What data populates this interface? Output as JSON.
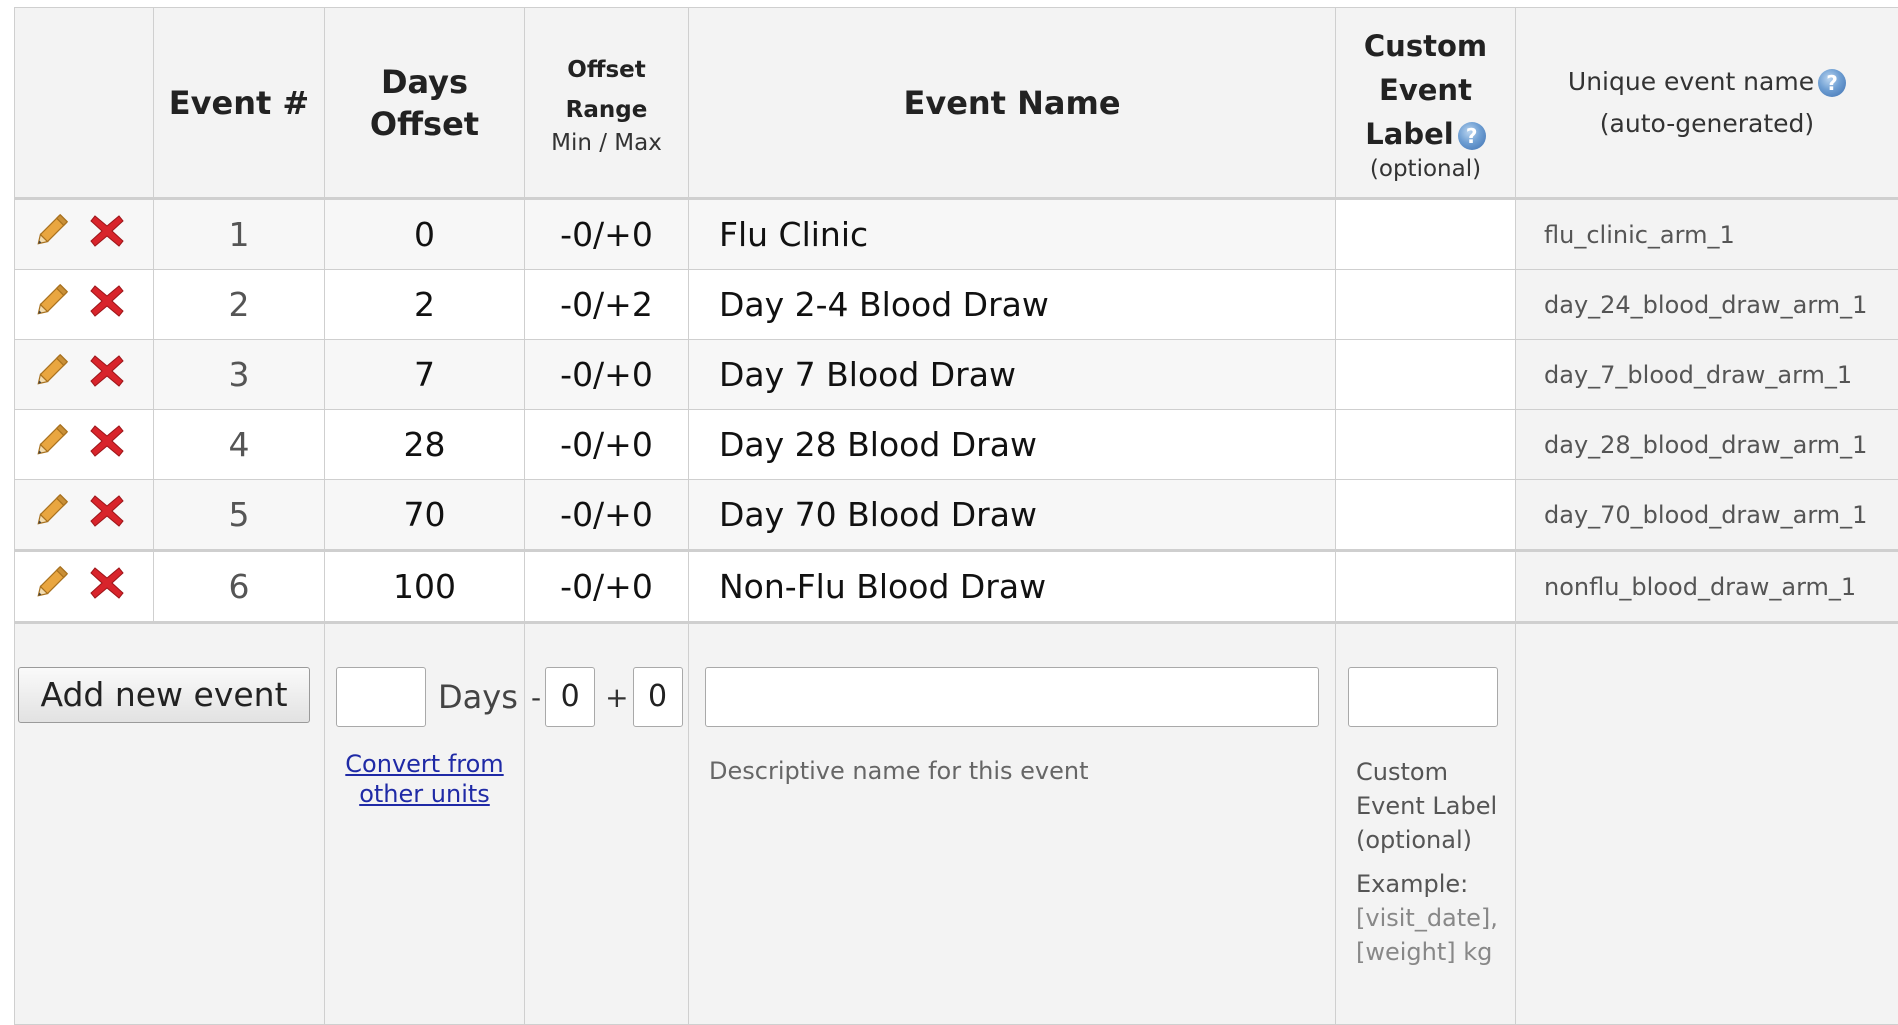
{
  "headers": {
    "event_num": "Event #",
    "days_offset": "Days Offset",
    "offset_range": "Offset Range",
    "min_max": "Min / Max",
    "event_name": "Event Name",
    "custom_label_1": "Custom",
    "custom_label_2": "Event",
    "custom_label_3": "Label",
    "custom_label_4": "(optional)",
    "unique_1": "Unique event name",
    "unique_2": "(auto-generated)"
  },
  "events": [
    {
      "num": "1",
      "days": "0",
      "range": "-0/+0",
      "name": "Flu Clinic",
      "unique": "flu_clinic_arm_1"
    },
    {
      "num": "2",
      "days": "2",
      "range": "-0/+2",
      "name": "Day 2-4 Blood Draw",
      "unique": "day_24_blood_draw_arm_1"
    },
    {
      "num": "3",
      "days": "7",
      "range": "-0/+0",
      "name": "Day 7 Blood Draw",
      "unique": "day_7_blood_draw_arm_1"
    },
    {
      "num": "4",
      "days": "28",
      "range": "-0/+0",
      "name": "Day 28 Blood Draw",
      "unique": "day_28_blood_draw_arm_1"
    },
    {
      "num": "5",
      "days": "70",
      "range": "-0/+0",
      "name": "Day 70 Blood Draw",
      "unique": "day_70_blood_draw_arm_1"
    },
    {
      "num": "6",
      "days": "100",
      "range": "-0/+0",
      "name": "Non-Flu Blood Draw",
      "unique": "nonflu_blood_draw_arm_1"
    }
  ],
  "add_form": {
    "button": "Add new event",
    "days_value": "",
    "days_suffix": "Days",
    "convert_1": "Convert from",
    "convert_2": "other units",
    "minus": "-",
    "plus": "+",
    "min_value": "0",
    "max_value": "0",
    "name_value": "",
    "name_help": "Descriptive name for this event",
    "label_value": "",
    "label_help_1": "Custom",
    "label_help_2": "Event Label",
    "label_help_3": "(optional)",
    "example_title": "Example:",
    "example_1": "[visit_date],",
    "example_2": "[weight] kg"
  },
  "icons": {
    "edit": "pencil-icon",
    "delete": "delete-x-icon",
    "help": "help-icon",
    "accent_delete": "#d8242b",
    "accent_pencil": "#e9a640"
  }
}
